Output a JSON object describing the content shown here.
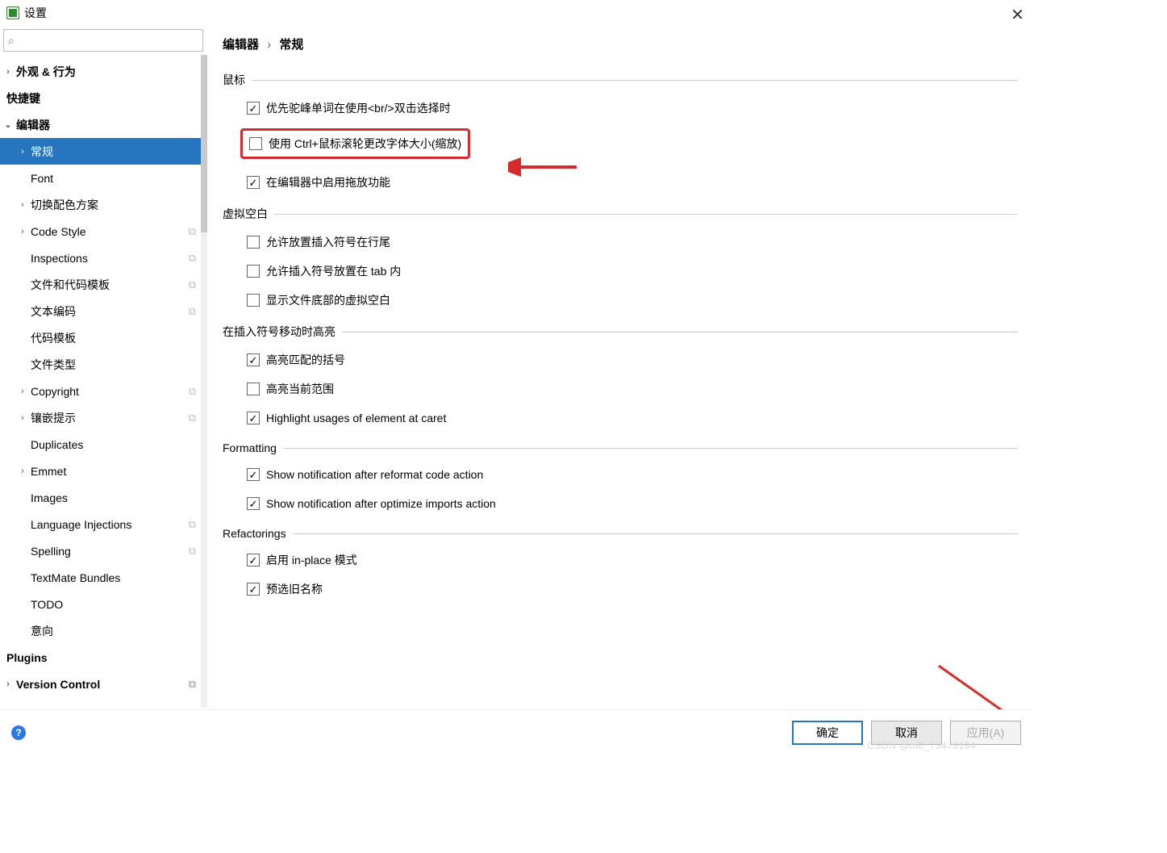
{
  "window": {
    "title": "设置"
  },
  "search": {
    "placeholder": ""
  },
  "sidebar": {
    "items": [
      {
        "label": "外观 & 行为",
        "level": 0,
        "arrow": "right",
        "bold": true
      },
      {
        "label": "快捷键",
        "level": 0,
        "arrow": "",
        "bold": true
      },
      {
        "label": "编辑器",
        "level": 0,
        "arrow": "down",
        "bold": true
      },
      {
        "label": "常规",
        "level": 1,
        "arrow": "right",
        "selected": true
      },
      {
        "label": "Font",
        "level": 1,
        "arrow": ""
      },
      {
        "label": "切换配色方案",
        "level": 1,
        "arrow": "right"
      },
      {
        "label": "Code Style",
        "level": 1,
        "arrow": "right",
        "copy": true
      },
      {
        "label": "Inspections",
        "level": 1,
        "arrow": "",
        "copy": true
      },
      {
        "label": "文件和代码模板",
        "level": 1,
        "arrow": "",
        "copy": true
      },
      {
        "label": "文本编码",
        "level": 1,
        "arrow": "",
        "copy": true
      },
      {
        "label": "代码模板",
        "level": 1,
        "arrow": ""
      },
      {
        "label": "文件类型",
        "level": 1,
        "arrow": ""
      },
      {
        "label": "Copyright",
        "level": 1,
        "arrow": "right",
        "copy": true
      },
      {
        "label": "镶嵌提示",
        "level": 1,
        "arrow": "right",
        "copy": true
      },
      {
        "label": "Duplicates",
        "level": 1,
        "arrow": ""
      },
      {
        "label": "Emmet",
        "level": 1,
        "arrow": "right"
      },
      {
        "label": "Images",
        "level": 1,
        "arrow": ""
      },
      {
        "label": "Language Injections",
        "level": 1,
        "arrow": "",
        "copy": true
      },
      {
        "label": "Spelling",
        "level": 1,
        "arrow": "",
        "copy": true
      },
      {
        "label": "TextMate Bundles",
        "level": 1,
        "arrow": ""
      },
      {
        "label": "TODO",
        "level": 1,
        "arrow": ""
      },
      {
        "label": "意向",
        "level": 1,
        "arrow": ""
      },
      {
        "label": "Plugins",
        "level": 0,
        "arrow": "",
        "bold": true
      },
      {
        "label": "Version Control",
        "level": 0,
        "arrow": "right",
        "bold": true,
        "copy": true
      }
    ]
  },
  "breadcrumb": {
    "part1": "编辑器",
    "sep": "›",
    "part2": "常规"
  },
  "sections": {
    "mouse": {
      "title": "鼠标",
      "opt1": "优先驼峰单词在使用<br/>双击选择时",
      "opt2": "使用 Ctrl+鼠标滚轮更改字体大小(缩放)",
      "opt3": "在编辑器中启用拖放功能"
    },
    "virtual": {
      "title": "虚拟空白",
      "opt1": "允许放置插入符号在行尾",
      "opt2": "允许插入符号放置在 tab 内",
      "opt3": "显示文件底部的虚拟空白"
    },
    "highlight": {
      "title": "在插入符号移动时高亮",
      "opt1": "高亮匹配的括号",
      "opt2": "高亮当前范围",
      "opt3": "Highlight usages of element at caret"
    },
    "formatting": {
      "title": "Formatting",
      "opt1": "Show notification after reformat code action",
      "opt2": "Show notification after optimize imports action"
    },
    "refactor": {
      "title": "Refactorings",
      "opt1": "启用 in-place 模式",
      "opt2": "预选旧名称"
    }
  },
  "footer": {
    "ok": "确定",
    "cancel": "取消",
    "apply": "应用(A)"
  },
  "watermark": "CSDN @m0_73479194"
}
